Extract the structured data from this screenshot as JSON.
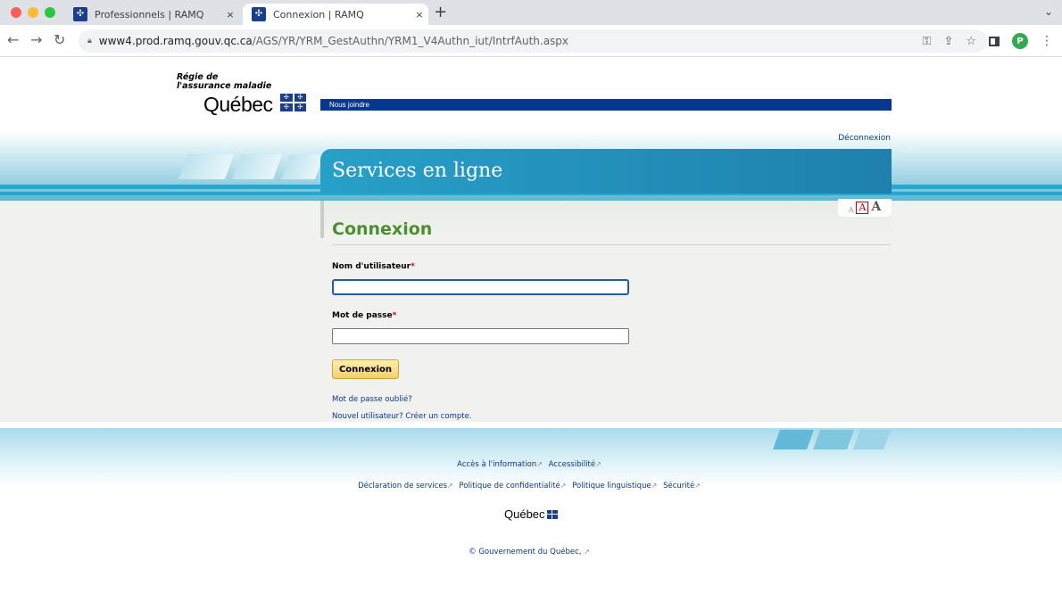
{
  "browser": {
    "tabs": [
      {
        "title": "Professionnels | RAMQ",
        "close": "×"
      },
      {
        "title": "Connexion | RAMQ",
        "close": "×"
      }
    ],
    "new_tab": "+",
    "tab_menu": "⌄",
    "url_host": "www4.prod.ramq.gouv.qc.ca",
    "url_path": "/AGS/YR/YRM_GestAuthn/YRM1_V4Authn_iut/IntrfAuth.aspx",
    "avatar_letter": "P"
  },
  "header": {
    "logo_line1": "Régie de",
    "logo_line2": "l'assurance maladie",
    "logo_quebec": "Québec",
    "nous_joindre": "Nous joindre",
    "deconnexion": "Déconnexion",
    "services_title": "Services en ligne",
    "font_small": "A",
    "font_medium": "A",
    "font_large": "A"
  },
  "form": {
    "title": "Connexion",
    "username_label": "Nom d'utilisateur",
    "password_label": "Mot de passe",
    "required_mark": "*",
    "username_value": "",
    "password_value": "",
    "submit_label": "Connexion",
    "forgot_link": "Mot de passe oublié?",
    "new_user_link": "Nouvel utilisateur? Créer un compte."
  },
  "footer": {
    "row1": [
      "Accès à l'information",
      "Accessibilité"
    ],
    "row2": [
      "Déclaration de services",
      "Politique de confidentialité",
      "Politique linguistique",
      "Sécurité"
    ],
    "quebec_logo": "Québec",
    "copyright": "© Gouvernement du Québec,"
  },
  "colors": {
    "brand_blue": "#063791",
    "title_green": "#4b8f2e",
    "band_blue": "#27a6cf"
  }
}
